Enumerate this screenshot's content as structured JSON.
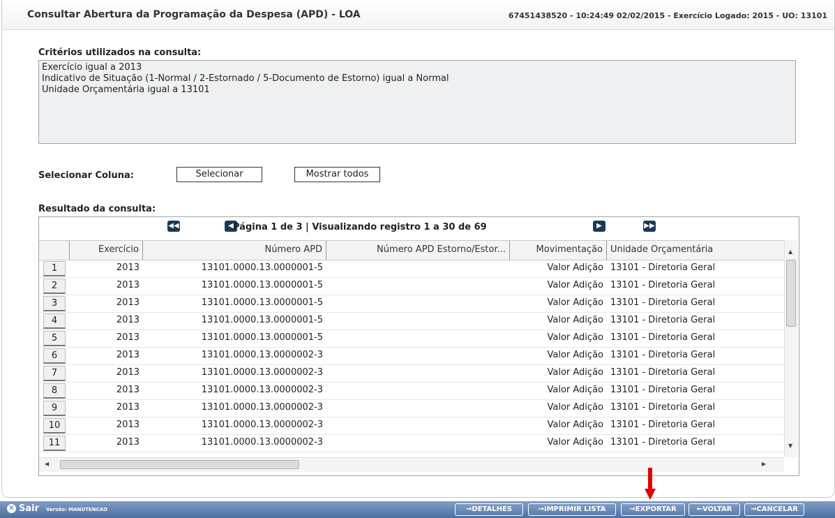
{
  "header": {
    "title": "Consultar Abertura da Programação da Despesa (APD) - LOA",
    "info": "67451438520 - 10:24:49 02/02/2015 - Exercício Logado: 2015 - UO: 13101"
  },
  "criteria": {
    "label": "Critérios utilizados na consulta:",
    "lines": [
      "Exercício igual a 2013",
      "Indicativo de Situação (1-Normal / 2-Estornado / 5-Documento de Estorno) igual a Normal",
      "Unidade Orçamentária igual a 13101"
    ]
  },
  "column_select": {
    "label": "Selecionar Coluna:",
    "select_button": "Selecionar",
    "show_all_button": "Mostrar todos"
  },
  "results": {
    "label": "Resultado da consulta:",
    "pager_text": "Página 1 de 3 | Visualizando registro 1 a 30 de 69",
    "pager_icons": [
      "first-page-icon",
      "prev-page-icon",
      "next-page-icon",
      "last-page-icon"
    ],
    "columns": [
      "Exercício",
      "Número APD",
      "Número APD Estorno/Estor...",
      "Movimentação",
      "Unidade Orçamentária"
    ],
    "rows": [
      {
        "n": "1",
        "exercicio": "2013",
        "numero": "13101.0000.13.0000001-5",
        "estorno": "",
        "mov": "Valor Adição",
        "uo": "13101 - Diretoria Geral"
      },
      {
        "n": "2",
        "exercicio": "2013",
        "numero": "13101.0000.13.0000001-5",
        "estorno": "",
        "mov": "Valor Adição",
        "uo": "13101 - Diretoria Geral"
      },
      {
        "n": "3",
        "exercicio": "2013",
        "numero": "13101.0000.13.0000001-5",
        "estorno": "",
        "mov": "Valor Adição",
        "uo": "13101 - Diretoria Geral"
      },
      {
        "n": "4",
        "exercicio": "2013",
        "numero": "13101.0000.13.0000001-5",
        "estorno": "",
        "mov": "Valor Adição",
        "uo": "13101 - Diretoria Geral"
      },
      {
        "n": "5",
        "exercicio": "2013",
        "numero": "13101.0000.13.0000001-5",
        "estorno": "",
        "mov": "Valor Adição",
        "uo": "13101 - Diretoria Geral"
      },
      {
        "n": "6",
        "exercicio": "2013",
        "numero": "13101.0000.13.0000002-3",
        "estorno": "",
        "mov": "Valor Adição",
        "uo": "13101 - Diretoria Geral"
      },
      {
        "n": "7",
        "exercicio": "2013",
        "numero": "13101.0000.13.0000002-3",
        "estorno": "",
        "mov": "Valor Adição",
        "uo": "13101 - Diretoria Geral"
      },
      {
        "n": "8",
        "exercicio": "2013",
        "numero": "13101.0000.13.0000002-3",
        "estorno": "",
        "mov": "Valor Adição",
        "uo": "13101 - Diretoria Geral"
      },
      {
        "n": "9",
        "exercicio": "2013",
        "numero": "13101.0000.13.0000002-3",
        "estorno": "",
        "mov": "Valor Adição",
        "uo": "13101 - Diretoria Geral"
      },
      {
        "n": "10",
        "exercicio": "2013",
        "numero": "13101.0000.13.0000002-3",
        "estorno": "",
        "mov": "Valor Adição",
        "uo": "13101 - Diretoria Geral"
      },
      {
        "n": "11",
        "exercicio": "2013",
        "numero": "13101.0000.13.0000002-3",
        "estorno": "",
        "mov": "Valor Adição",
        "uo": "13101 - Diretoria Geral"
      }
    ]
  },
  "footer": {
    "exit_label": "Sair",
    "version": "Versão: MANUTENCAO",
    "buttons": [
      "→DETALHES",
      "→IMPRIMIR LISTA",
      "→EXPORTAR",
      "←VOLTAR",
      "→CANCELAR"
    ]
  },
  "annotation": {
    "arrow_color": "#e00000"
  }
}
